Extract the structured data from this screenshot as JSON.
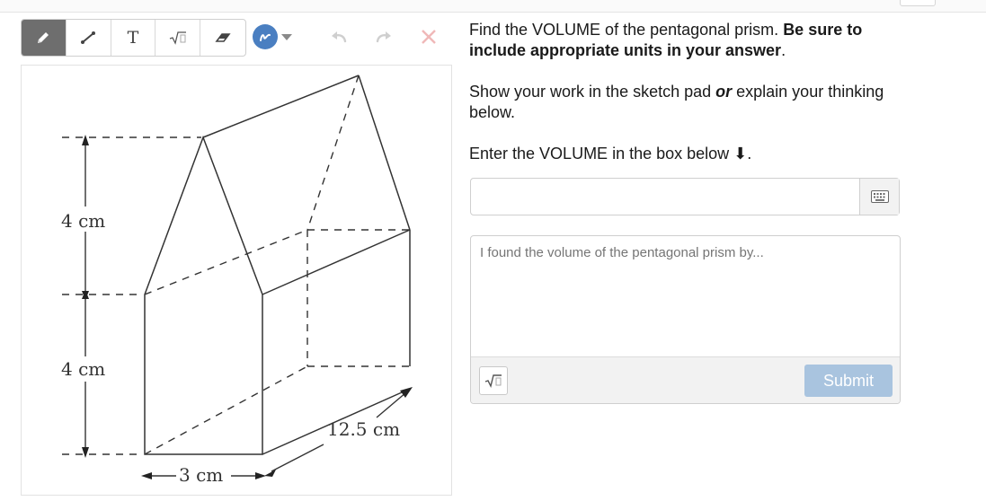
{
  "question": {
    "line1_normal": "Find the VOLUME of the pentagonal prism.  ",
    "line1_bold": "Be sure to include appropriate units in your answer",
    "line1_end": ".",
    "work_pre": "Show your work in the sketch pad ",
    "work_or": "or",
    "work_post": " explain your thinking below.",
    "enter": "Enter the VOLUME in the box below ⬇."
  },
  "toolbar": {
    "tools": [
      {
        "icon": "pencil-icon",
        "active": true
      },
      {
        "icon": "line-icon",
        "active": false
      },
      {
        "icon": "text-icon",
        "glyph": "T",
        "active": false
      },
      {
        "icon": "sqrt-icon",
        "active": false
      },
      {
        "icon": "eraser-icon",
        "active": false
      }
    ],
    "stroke_color": "#4a7fc1"
  },
  "figure": {
    "labels": {
      "height_top": "4 cm",
      "height_bottom": "4 cm",
      "width": "3 cm",
      "length": "12.5 cm"
    }
  },
  "answer": {
    "value": ""
  },
  "explain": {
    "placeholder": "I found the volume of the pentagonal prism by..."
  },
  "submit_label": "Submit",
  "colors": {
    "accent": "#4a7fc1",
    "submit_disabled": "#a9c4df"
  }
}
